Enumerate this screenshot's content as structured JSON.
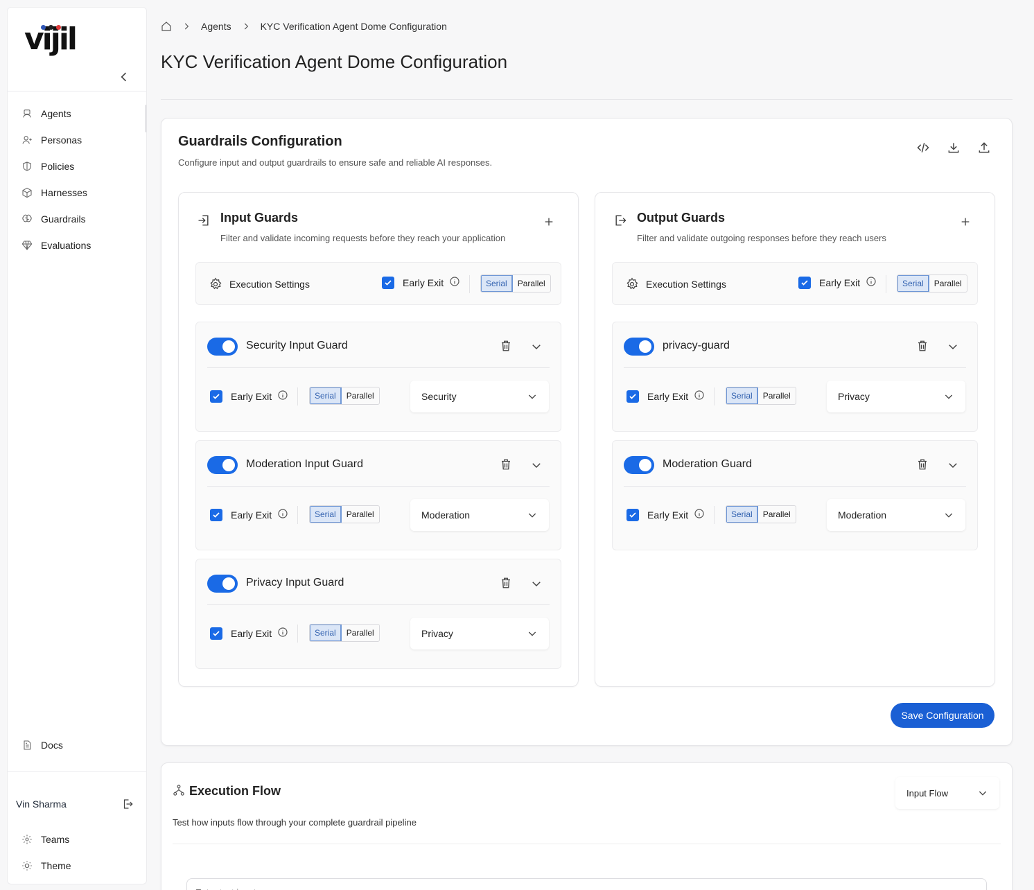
{
  "app": {
    "logo_text": "vijil",
    "logo_colors": [
      "#2f56b5",
      "#222222",
      "#e03a3a"
    ]
  },
  "sidebar": {
    "nav": [
      {
        "label": "Agents",
        "icon": "agent-icon"
      },
      {
        "label": "Personas",
        "icon": "persona-icon"
      },
      {
        "label": "Policies",
        "icon": "shield-icon"
      },
      {
        "label": "Harnesses",
        "icon": "cube-icon"
      },
      {
        "label": "Guardrails",
        "icon": "brain-icon"
      },
      {
        "label": "Evaluations",
        "icon": "diamond-icon"
      }
    ],
    "docs": {
      "label": "Docs",
      "icon": "doc-icon"
    },
    "user": {
      "name": "Vin Sharma"
    },
    "bottom": [
      {
        "label": "Teams",
        "icon": "teams-icon"
      },
      {
        "label": "Theme",
        "icon": "sun-icon"
      }
    ]
  },
  "breadcrumb": {
    "items": [
      "Agents",
      "KYC Verification Agent Dome Configuration"
    ]
  },
  "page": {
    "title": "KYC Verification Agent Dome Configuration"
  },
  "guardrails": {
    "title": "Guardrails Configuration",
    "subtitle": "Configure input and output guardrails to ensure safe and reliable AI responses.",
    "save_label": "Save Configuration",
    "input": {
      "title": "Input Guards",
      "subtitle": "Filter and validate incoming requests before they reach your application",
      "exec": {
        "label": "Execution Settings",
        "early_exit": "Early Exit",
        "serial": "Serial",
        "parallel": "Parallel"
      },
      "guards": [
        {
          "name": "Security Input Guard",
          "early_exit": "Early Exit",
          "serial": "Serial",
          "parallel": "Parallel",
          "type": "Security"
        },
        {
          "name": "Moderation Input Guard",
          "early_exit": "Early Exit",
          "serial": "Serial",
          "parallel": "Parallel",
          "type": "Moderation"
        },
        {
          "name": "Privacy Input Guard",
          "early_exit": "Early Exit",
          "serial": "Serial",
          "parallel": "Parallel",
          "type": "Privacy"
        }
      ]
    },
    "output": {
      "title": "Output Guards",
      "subtitle": "Filter and validate outgoing responses before they reach users",
      "exec": {
        "label": "Execution Settings",
        "early_exit": "Early Exit",
        "serial": "Serial",
        "parallel": "Parallel"
      },
      "guards": [
        {
          "name": "privacy-guard",
          "early_exit": "Early Exit",
          "serial": "Serial",
          "parallel": "Parallel",
          "type": "Privacy"
        },
        {
          "name": "Moderation Guard",
          "early_exit": "Early Exit",
          "serial": "Serial",
          "parallel": "Parallel",
          "type": "Moderation"
        }
      ]
    }
  },
  "execution_flow": {
    "title": "Execution Flow",
    "subtitle": "Test how inputs flow through your complete guardrail pipeline",
    "flow_select": "Input Flow",
    "input_placeholder": "Enter test input..."
  }
}
